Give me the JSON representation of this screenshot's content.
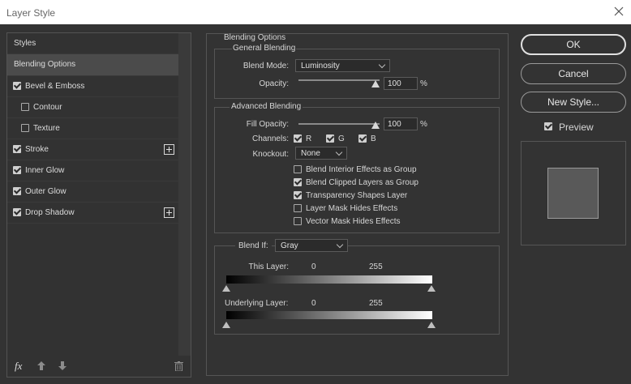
{
  "window": {
    "title": "Layer Style",
    "close_icon": "close-icon"
  },
  "styles_list": {
    "header": "Styles",
    "items": [
      {
        "label": "Blending Options",
        "selected": true,
        "checkbox": null,
        "add": false
      },
      {
        "label": "Bevel & Emboss",
        "checked": true,
        "add": false
      },
      {
        "label": "Contour",
        "checked": false,
        "add": false
      },
      {
        "label": "Texture",
        "checked": false,
        "add": false
      },
      {
        "label": "Stroke",
        "checked": true,
        "add": true
      },
      {
        "label": "Inner Glow",
        "checked": true,
        "add": false
      },
      {
        "label": "Outer Glow",
        "checked": true,
        "add": false
      },
      {
        "label": "Drop Shadow",
        "checked": true,
        "add": true
      }
    ],
    "footer_icons": [
      "fx-icon",
      "arrow-up-icon",
      "arrow-down-icon",
      "trash-icon"
    ],
    "fx_label": "fx"
  },
  "blending": {
    "title": "Blending Options",
    "general": {
      "title": "General Blending",
      "blend_mode_label": "Blend Mode:",
      "blend_mode_value": "Luminosity",
      "opacity_label": "Opacity:",
      "opacity_value": "100",
      "opacity_unit": "%"
    },
    "advanced": {
      "title": "Advanced Blending",
      "fill_opacity_label": "Fill Opacity:",
      "fill_opacity_value": "100",
      "fill_opacity_unit": "%",
      "channels_label": "Channels:",
      "channels": [
        {
          "label": "R",
          "checked": true
        },
        {
          "label": "G",
          "checked": true
        },
        {
          "label": "B",
          "checked": true
        }
      ],
      "knockout_label": "Knockout:",
      "knockout_value": "None",
      "options": [
        {
          "label": "Blend Interior Effects as Group",
          "checked": false
        },
        {
          "label": "Blend Clipped Layers as Group",
          "checked": true
        },
        {
          "label": "Transparency Shapes Layer",
          "checked": true
        },
        {
          "label": "Layer Mask Hides Effects",
          "checked": false
        },
        {
          "label": "Vector Mask Hides Effects",
          "checked": false
        }
      ]
    },
    "blend_if": {
      "label": "Blend If:",
      "value": "Gray",
      "this_layer_label": "This Layer:",
      "this_layer_min": "0",
      "this_layer_max": "255",
      "underlying_label": "Underlying Layer:",
      "underlying_min": "0",
      "underlying_max": "255"
    }
  },
  "buttons": {
    "ok": "OK",
    "cancel": "Cancel",
    "new_style": "New Style...",
    "preview_label": "Preview",
    "preview_checked": true
  },
  "colors": {
    "dialog_bg": "#333333",
    "panel_bg": "#323232",
    "selected_row": "#4b4b4b",
    "preview_swatch": "#595959"
  }
}
